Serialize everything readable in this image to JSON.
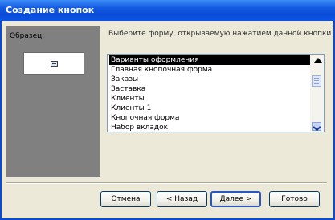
{
  "window": {
    "title": "Создание кнопок"
  },
  "sample": {
    "label": "Образец:",
    "preview_icon": "form-icon"
  },
  "instruction": "Выберите форму, открываемую нажатием данной кнопки.",
  "list": {
    "items": [
      "Варианты оформления",
      "Главная кнопочная форма",
      "Заказы",
      "Заставка",
      "Клиенты",
      "Клиенты 1",
      "Кнопочная форма",
      "Набор вкладок"
    ],
    "selected_index": 0
  },
  "buttons": {
    "cancel": "Отмена",
    "back": "< Назад",
    "next": "Далее >",
    "finish": "Готово"
  },
  "colors": {
    "titlebar": "#0a4bd6",
    "panel": "#808080",
    "selection": "#000000"
  }
}
